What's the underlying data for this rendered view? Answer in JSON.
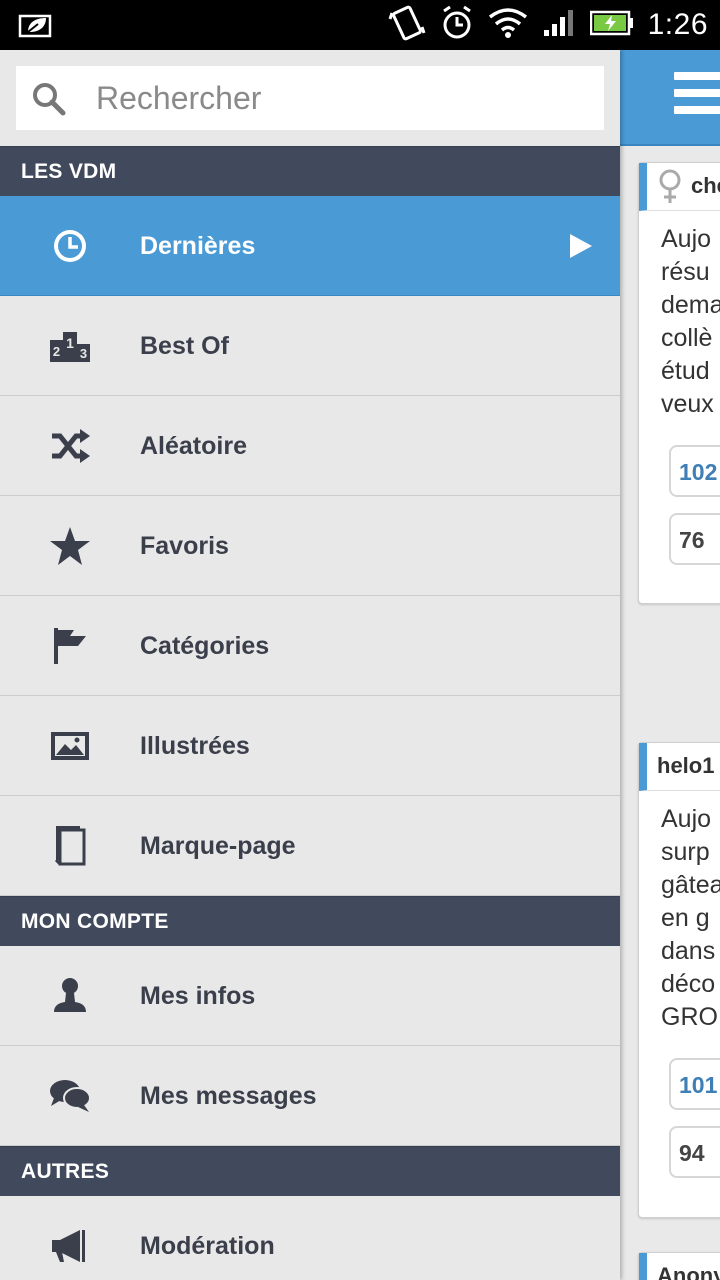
{
  "status_bar": {
    "time": "1:26",
    "icons": [
      "notification-leaf-icon",
      "vibrate-icon",
      "alarm-icon",
      "wifi-icon",
      "signal-icon",
      "battery-charging-icon"
    ]
  },
  "search": {
    "placeholder": "Rechercher"
  },
  "sections": [
    {
      "title": "LES VDM",
      "items": [
        {
          "label": "Dernières",
          "icon": "clock-icon",
          "active": true
        },
        {
          "label": "Best Of",
          "icon": "podium-icon"
        },
        {
          "label": "Aléatoire",
          "icon": "shuffle-icon"
        },
        {
          "label": "Favoris",
          "icon": "star-icon"
        },
        {
          "label": "Catégories",
          "icon": "flag-icon"
        },
        {
          "label": "Illustrées",
          "icon": "image-icon"
        },
        {
          "label": "Marque-page",
          "icon": "bookmark-pages-icon"
        }
      ]
    },
    {
      "title": "MON COMPTE",
      "items": [
        {
          "label": "Mes infos",
          "icon": "user-icon"
        },
        {
          "label": "Mes messages",
          "icon": "chat-bubbles-icon"
        }
      ]
    },
    {
      "title": "AUTRES",
      "items": [
        {
          "label": "Modération",
          "icon": "megaphone-icon"
        }
      ]
    }
  ],
  "posts": [
    {
      "author": "che",
      "gender_icon": "female-icon",
      "lines": [
        "Aujo",
        "résu",
        "dema",
        "collè",
        "étud",
        "veux"
      ],
      "votes": [
        "102",
        "76"
      ]
    },
    {
      "author": "helo1",
      "lines": [
        "Aujo",
        "surp",
        "gâtea",
        "en g",
        "dans",
        "déco",
        "GRO"
      ],
      "votes": [
        "101",
        "94"
      ]
    },
    {
      "author": "Anony"
    }
  ],
  "colors": {
    "accent": "#4a9ad6",
    "section_bg": "#414a5c",
    "drawer_bg": "#e8e8e8",
    "vote_blue": "#3f7fb5"
  }
}
